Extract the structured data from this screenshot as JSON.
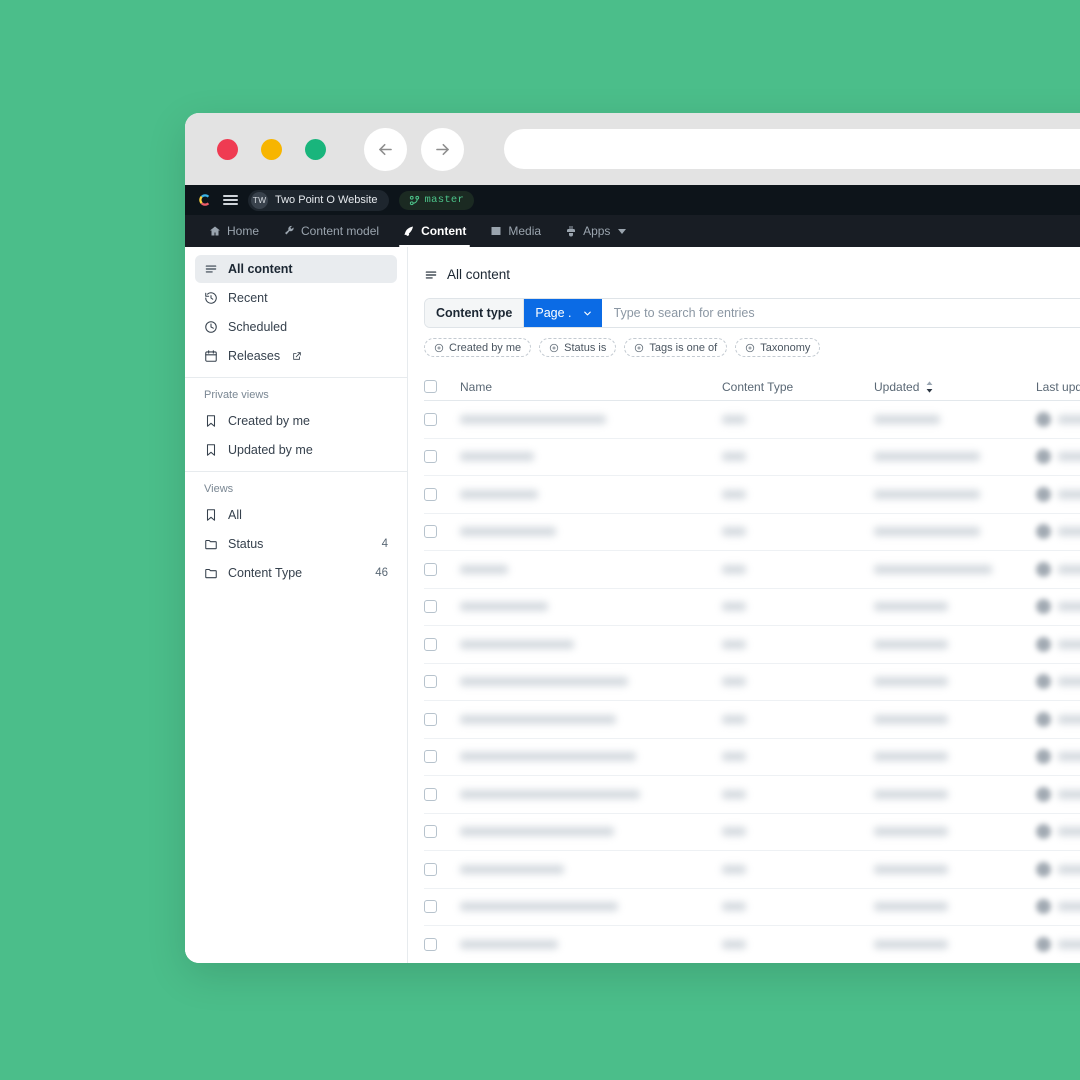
{
  "theme": {
    "page_background": "#4bbe8a",
    "accent_blue": "#0b6be5",
    "header_dark": "#0d141a",
    "nav_dark": "#181d24",
    "branch_green": "#4cc38a"
  },
  "browser": {
    "traffic_lights": [
      "close-red",
      "minimize-yellow",
      "maximize-green"
    ],
    "back_label": "Back",
    "forward_label": "Forward",
    "url_value": "",
    "url_placeholder": ""
  },
  "app_header": {
    "logo_name": "contentful-logo",
    "menu_label": "Menu",
    "space_initials": "TW",
    "space_name": "Two Point O Website",
    "branch_name": "master"
  },
  "app_nav": {
    "items": [
      {
        "label": "Home",
        "icon": "home-icon",
        "active": false,
        "has_caret": false
      },
      {
        "label": "Content model",
        "icon": "wrench-icon",
        "active": false,
        "has_caret": false
      },
      {
        "label": "Content",
        "icon": "pen-icon",
        "active": true,
        "has_caret": false
      },
      {
        "label": "Media",
        "icon": "image-icon",
        "active": false,
        "has_caret": false
      },
      {
        "label": "Apps",
        "icon": "plug-icon",
        "active": false,
        "has_caret": true
      }
    ]
  },
  "sidebar": {
    "primary_items": [
      {
        "label": "All content",
        "icon": "list-icon",
        "active": true,
        "external": false
      },
      {
        "label": "Recent",
        "icon": "history-icon",
        "active": false,
        "external": false
      },
      {
        "label": "Scheduled",
        "icon": "clock-icon",
        "active": false,
        "external": false
      },
      {
        "label": "Releases",
        "icon": "calendar-icon",
        "active": false,
        "external": true
      }
    ],
    "private_views_title": "Private views",
    "private_views": [
      {
        "label": "Created by me",
        "icon": "bookmark-icon"
      },
      {
        "label": "Updated by me",
        "icon": "bookmark-icon"
      }
    ],
    "views_title": "Views",
    "views": [
      {
        "label": "All",
        "icon": "bookmark-icon",
        "count": ""
      },
      {
        "label": "Status",
        "icon": "folder-icon",
        "count": "4"
      },
      {
        "label": "Content Type",
        "icon": "folder-icon",
        "count": "46"
      }
    ]
  },
  "main": {
    "title": "All content",
    "title_icon": "list-icon",
    "content_type_label": "Content type",
    "content_type_value": "Page .",
    "search_value": "",
    "search_placeholder": "Type to search for entries",
    "filter_chips": [
      {
        "label": "Created by me",
        "icon": "circle-plus-icon"
      },
      {
        "label": "Status is",
        "icon": "circle-plus-icon"
      },
      {
        "label": "Tags is one of",
        "icon": "circle-plus-icon"
      },
      {
        "label": "Taxonomy",
        "icon": "circle-plus-icon"
      }
    ],
    "table": {
      "columns": [
        {
          "key": "name",
          "label": "Name",
          "sortable": false
        },
        {
          "key": "content_type",
          "label": "Content Type",
          "sortable": false
        },
        {
          "key": "updated",
          "label": "Updated",
          "sortable": true,
          "sort_direction": "desc"
        },
        {
          "key": "last_updated_by",
          "label": "Last updated by",
          "sortable": false
        }
      ],
      "redacted": true,
      "rows": [
        {
          "name_w": 146,
          "type_w": 24,
          "updated_w": 66,
          "author_w": 60
        },
        {
          "name_w": 74,
          "type_w": 24,
          "updated_w": 106,
          "author_w": 54
        },
        {
          "name_w": 78,
          "type_w": 24,
          "updated_w": 106,
          "author_w": 54
        },
        {
          "name_w": 96,
          "type_w": 24,
          "updated_w": 106,
          "author_w": 54
        },
        {
          "name_w": 48,
          "type_w": 24,
          "updated_w": 118,
          "author_w": 58
        },
        {
          "name_w": 88,
          "type_w": 24,
          "updated_w": 74,
          "author_w": 54
        },
        {
          "name_w": 114,
          "type_w": 24,
          "updated_w": 74,
          "author_w": 54
        },
        {
          "name_w": 168,
          "type_w": 24,
          "updated_w": 74,
          "author_w": 54
        },
        {
          "name_w": 156,
          "type_w": 24,
          "updated_w": 74,
          "author_w": 54
        },
        {
          "name_w": 176,
          "type_w": 24,
          "updated_w": 74,
          "author_w": 54
        },
        {
          "name_w": 180,
          "type_w": 24,
          "updated_w": 74,
          "author_w": 54
        },
        {
          "name_w": 154,
          "type_w": 24,
          "updated_w": 74,
          "author_w": 54
        },
        {
          "name_w": 104,
          "type_w": 24,
          "updated_w": 74,
          "author_w": 54
        },
        {
          "name_w": 158,
          "type_w": 24,
          "updated_w": 74,
          "author_w": 54
        },
        {
          "name_w": 98,
          "type_w": 24,
          "updated_w": 74,
          "author_w": 54
        }
      ]
    }
  }
}
